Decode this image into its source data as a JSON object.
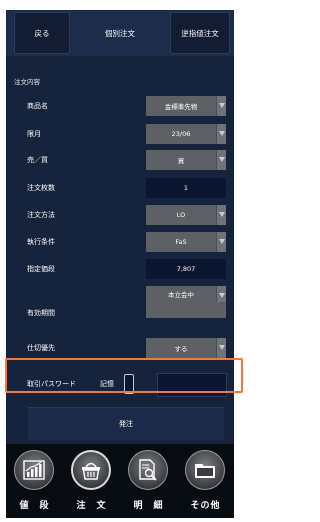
{
  "header": {
    "back_label": "戻る",
    "title": "個別注文",
    "switch_label": "逆指値注文"
  },
  "section_title": "注文内容",
  "fields": {
    "product": {
      "label": "商品名",
      "value": "金標準先物"
    },
    "month": {
      "label": "限月",
      "value": "23/06"
    },
    "side": {
      "label": "売／買",
      "value": "買"
    },
    "qty": {
      "label": "注文枚数",
      "value": "1"
    },
    "method": {
      "label": "注文方法",
      "value": "LO"
    },
    "condition": {
      "label": "執行条件",
      "value": "FaS"
    },
    "price": {
      "label": "指定価段",
      "value": "7,807"
    },
    "validity": {
      "label": "有効期間",
      "value": "本立会中"
    },
    "pending": {
      "label": "仕切優先",
      "value": "する"
    }
  },
  "password": {
    "label": "取引パスワード",
    "remember_label": "記憶"
  },
  "submit_label": "発注",
  "tabs": [
    {
      "label": "値　段",
      "icon": "chart-icon"
    },
    {
      "label": "注　文",
      "icon": "basket-icon"
    },
    {
      "label": "明　細",
      "icon": "document-search-icon"
    },
    {
      "label": "その他",
      "icon": "folder-icon"
    }
  ],
  "colors": {
    "background": "#16233d",
    "highlight": "#f07a3c"
  }
}
